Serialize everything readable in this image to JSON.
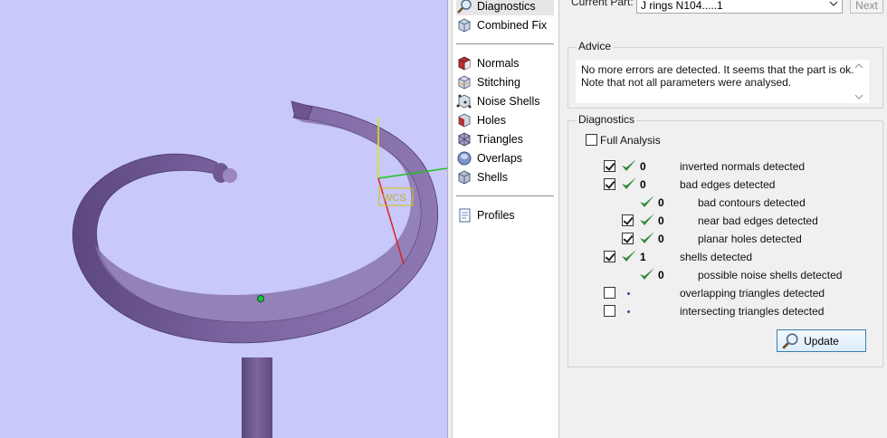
{
  "tools": {
    "primary": [
      {
        "label": "Diagnostics",
        "icon": "magnifier-icon",
        "selected": true
      },
      {
        "label": "Combined Fix",
        "icon": "cube-icon"
      }
    ],
    "checks": [
      {
        "label": "Normals",
        "icon": "normals-icon"
      },
      {
        "label": "Stitching",
        "icon": "stitching-icon"
      },
      {
        "label": "Noise Shells",
        "icon": "noise-shells-icon"
      },
      {
        "label": "Holes",
        "icon": "holes-icon"
      },
      {
        "label": "Triangles",
        "icon": "triangles-icon"
      },
      {
        "label": "Overlaps",
        "icon": "overlaps-icon"
      },
      {
        "label": "Shells",
        "icon": "shells-icon"
      }
    ],
    "extra": [
      {
        "label": "Profiles",
        "icon": "profiles-icon"
      }
    ]
  },
  "current_part": {
    "label": "Current Part:",
    "value": "J rings N104.....1",
    "next_label": "Next"
  },
  "advice": {
    "title": "Advice",
    "line1": "No more errors are detected. It seems that the part is ok.",
    "line2": "Note that not all parameters were analysed."
  },
  "diagnostics": {
    "title": "Diagnostics",
    "full_analysis_label": "Full Analysis",
    "full_analysis_checked": false,
    "rows": [
      {
        "checked": true,
        "status": "ok",
        "count": "0",
        "label": "inverted normals detected",
        "indent": 0
      },
      {
        "checked": true,
        "status": "ok",
        "count": "0",
        "label": "bad edges detected",
        "indent": 0
      },
      {
        "checked": null,
        "status": "ok",
        "count": "0",
        "label": "bad contours detected",
        "indent": 1
      },
      {
        "checked": true,
        "status": "ok",
        "count": "0",
        "label": "near bad edges detected",
        "indent": 1
      },
      {
        "checked": true,
        "status": "ok",
        "count": "0",
        "label": "planar holes detected",
        "indent": 1
      },
      {
        "checked": true,
        "status": "ok",
        "count": "1",
        "label": "shells detected",
        "indent": 0
      },
      {
        "checked": null,
        "status": "ok",
        "count": "0",
        "label": "possible noise shells detected",
        "indent": 1
      },
      {
        "checked": false,
        "status": "pending",
        "count": "",
        "label": "overlapping triangles detected",
        "indent": 0
      },
      {
        "checked": false,
        "status": "pending",
        "count": "",
        "label": "intersecting triangles detected",
        "indent": 0
      }
    ],
    "update_label": "Update"
  },
  "viewport": {
    "axis_label": "WCS",
    "background_color": "#c8c8fa",
    "model_color": "#7a629c"
  },
  "colors": {
    "check_green": "#2e8b3a",
    "button_border": "#3c7fb1"
  }
}
